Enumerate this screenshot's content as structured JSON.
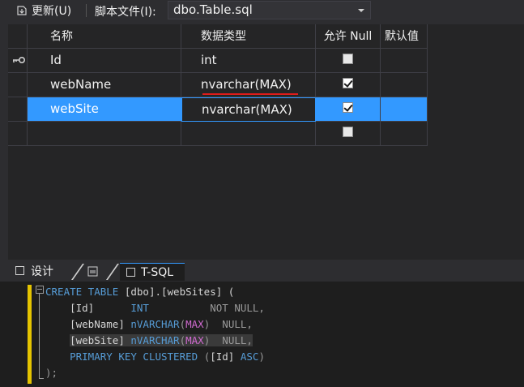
{
  "toolbar": {
    "update_label": "更新(U)",
    "script_file_label": "脚本文件(I):",
    "script_file_value": "dbo.Table.sql"
  },
  "grid": {
    "headers": {
      "name": "名称",
      "data_type": "数据类型",
      "allow_null": "允许 Null",
      "default": "默认值"
    },
    "rows": [
      {
        "name": "Id",
        "data_type": "int",
        "allow_null": false,
        "primary_key": true
      },
      {
        "name": "webName",
        "data_type": "nvarchar(MAX)",
        "allow_null": true,
        "primary_key": false
      },
      {
        "name": "webSite",
        "data_type": "nvarchar(MAX)",
        "allow_null": true,
        "primary_key": false,
        "selected": true
      },
      {
        "name": "",
        "data_type": "",
        "allow_null": false,
        "primary_key": false
      }
    ]
  },
  "tabs": {
    "design": "设计",
    "tsql": "T-SQL"
  },
  "code": {
    "line1_kw": "CREATE TABLE",
    "line1_rest": " [dbo].[webSites] (",
    "line2_col": "[Id]",
    "line2_type": "INT",
    "line2_null": "NOT NULL,",
    "line3_col": "[webName]",
    "line3_type": "nVARCHAR",
    "line3_max": "MAX",
    "line3_null": "NULL,",
    "line4_col": "[webSite]",
    "line4_type": "nVARCHAR",
    "line4_max": "MAX",
    "line4_null": "NULL,",
    "line5_kw": "PRIMARY KEY CLUSTERED",
    "line5_col": "[Id]",
    "line5_asc": "ASC",
    "line6": ");"
  },
  "colors": {
    "accent": "#3399ff",
    "keyword": "#569cd6",
    "function": "#d16bd1",
    "change_marker": "#e5c400",
    "squiggle": "#e01b1b"
  }
}
